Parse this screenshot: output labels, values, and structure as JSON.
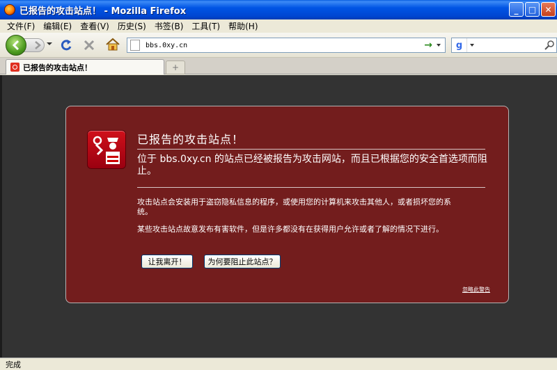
{
  "window": {
    "title": "已报告的攻击站点！ - Mozilla Firefox",
    "buttons": {
      "minimize": "_",
      "maximize": "□",
      "close": "✕"
    }
  },
  "menu": {
    "items": [
      "文件(F)",
      "编辑(E)",
      "查看(V)",
      "历史(S)",
      "书签(B)",
      "工具(T)",
      "帮助(H)"
    ]
  },
  "nav": {
    "url": "bbs.0xy.cn",
    "search_placeholder": ""
  },
  "tabs": [
    {
      "label": "已报告的攻击站点！",
      "active": true
    }
  ],
  "new_tab_symbol": "+",
  "warning": {
    "title": "已报告的攻击站点！",
    "short_desc": "位于 bbs.0xy.cn 的站点已经被报告为攻击网站，而且已根据您的安全首选项而阻止。",
    "long_desc_1": "攻击站点会安装用于盗窃隐私信息的程序，或使用您的计算机来攻击其他人，或者损坏您的系统。",
    "long_desc_2": "某些攻击站点故意发布有害软件，但是许多都没有在获得用户允许或者了解的情况下进行。",
    "leave_button": "让我离开！",
    "why_button": "为何要阻止此站点？",
    "ignore_link": "忽略此警告"
  },
  "status": {
    "text": "完成"
  },
  "colors": {
    "warning_background": "#731d1d",
    "content_background": "#333333",
    "titlebar": "#0055e5"
  }
}
